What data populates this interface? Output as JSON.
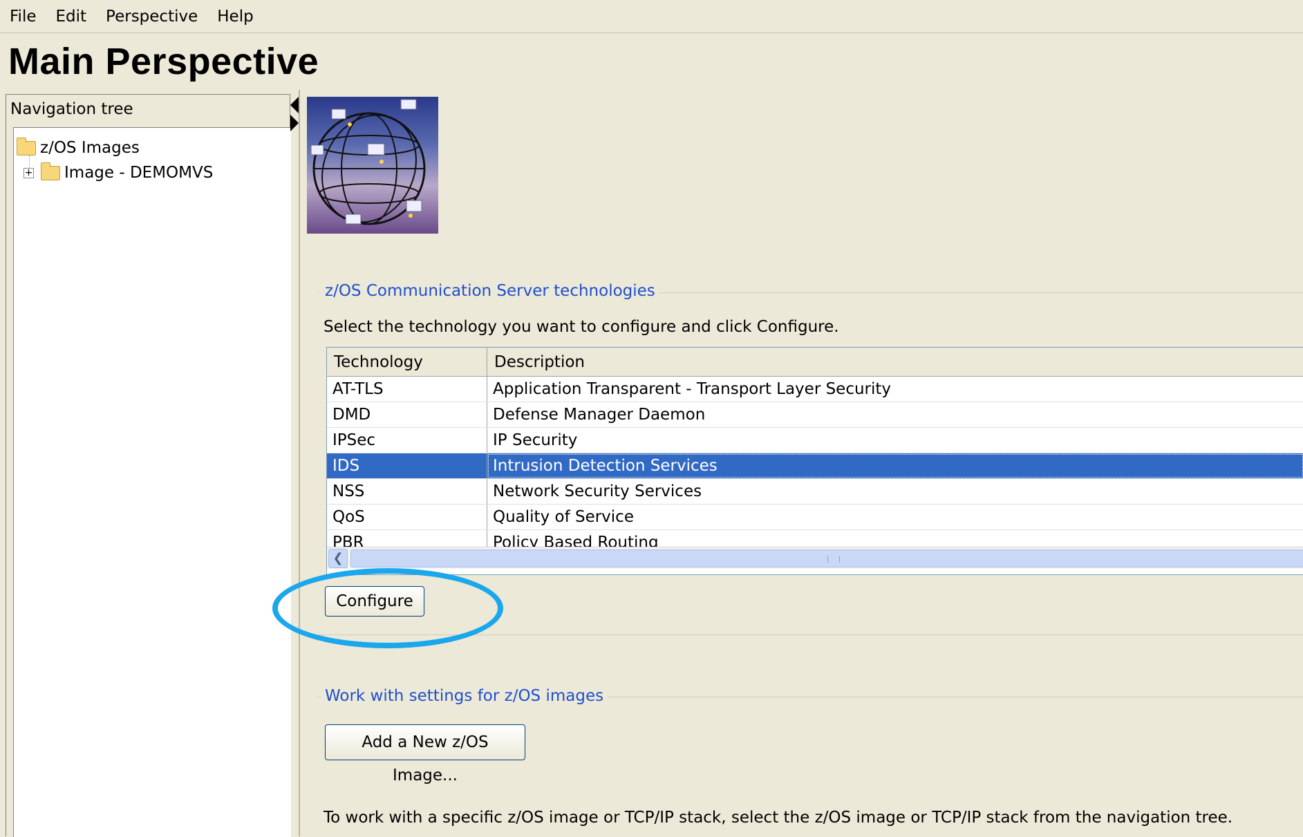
{
  "menubar": {
    "items": [
      "File",
      "Edit",
      "Perspective",
      "Help"
    ]
  },
  "page": {
    "title": "Main Perspective"
  },
  "navigation": {
    "title": "Navigation tree",
    "tree": [
      {
        "label": "z/OS Images",
        "icon": "folder-open-icon"
      },
      {
        "label": "Image - DEMOMVS",
        "icon": "folder-icon",
        "expander": "+"
      }
    ]
  },
  "technologies": {
    "group_title": "z/OS Communication Server technologies",
    "instructions": "Select the  technology you want to configure and click Configure.",
    "columns": [
      "Technology",
      "Description"
    ],
    "rows": [
      {
        "technology": "AT-TLS",
        "description": "Application Transparent - Transport Layer Security"
      },
      {
        "technology": "DMD",
        "description": "Defense Manager Daemon"
      },
      {
        "technology": "IPSec",
        "description": "IP Security"
      },
      {
        "technology": "IDS",
        "description": "Intrusion Detection Services",
        "selected": true
      },
      {
        "technology": "NSS",
        "description": "Network Security Services"
      },
      {
        "technology": "QoS",
        "description": "Quality of Service"
      },
      {
        "technology": "PBR",
        "description": "Policy Based Routing"
      }
    ],
    "configure_label": "Configure"
  },
  "images": {
    "group_title": "Work with settings for z/OS images",
    "add_label": "Add a New z/OS Image..."
  },
  "footer": {
    "text": "To work with a specific z/OS image or TCP/IP stack, select the z/OS image or TCP/IP stack from the navigation tree."
  },
  "colors": {
    "background": "#ece9d8",
    "selection": "#316ac5",
    "group_title": "#1f4fcf",
    "highlight": "#1aa7ec"
  }
}
